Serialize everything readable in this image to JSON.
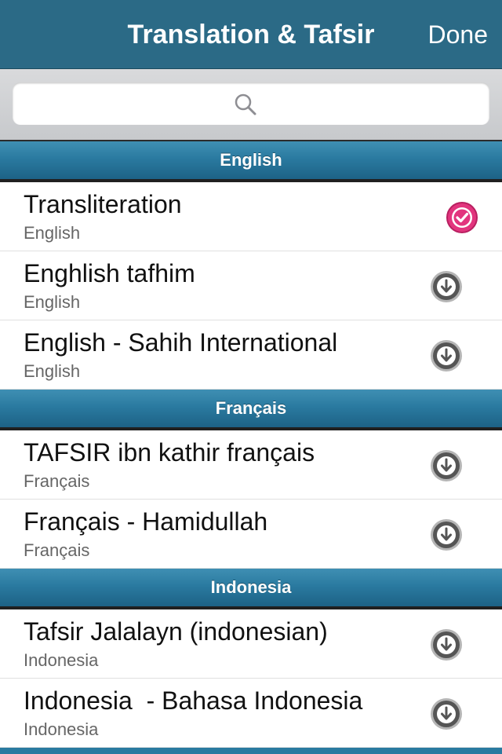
{
  "navbar": {
    "title": "Translation & Tafsir",
    "done_label": "Done"
  },
  "search": {
    "value": "",
    "placeholder": ""
  },
  "sections": [
    {
      "header": "English",
      "rows": [
        {
          "title": "Transliteration",
          "subtitle": "English",
          "status": "selected",
          "icon": "check-icon"
        },
        {
          "title": "Enghlish tafhim",
          "subtitle": "English",
          "status": "download",
          "icon": "download-icon"
        },
        {
          "title": "English - Sahih International",
          "subtitle": "English",
          "status": "download",
          "icon": "download-icon"
        }
      ]
    },
    {
      "header": "Français",
      "rows": [
        {
          "title": "TAFSIR ibn kathir français",
          "subtitle": "Français",
          "status": "download",
          "icon": "download-icon"
        },
        {
          "title": "Français - Hamidullah",
          "subtitle": "Français",
          "status": "download",
          "icon": "download-icon"
        }
      ]
    },
    {
      "header": "Indonesia",
      "rows": [
        {
          "title": "Tafsir Jalalayn (indonesian)",
          "subtitle": "Indonesia",
          "status": "download",
          "icon": "download-icon"
        },
        {
          "title": "Indonesia  - Bahasa Indonesia",
          "subtitle": "Indonesia",
          "status": "download",
          "icon": "download-icon"
        }
      ]
    }
  ],
  "colors": {
    "navbar": "#2b6a86",
    "section_header": "#2a7aa0",
    "selected": "#e2357e",
    "download_icon": "#555555"
  }
}
